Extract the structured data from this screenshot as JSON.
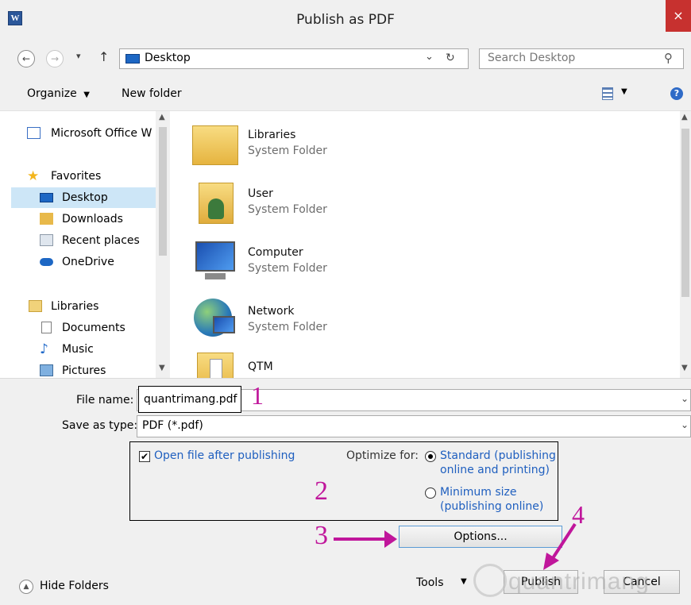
{
  "window": {
    "title": "Publish as PDF",
    "app_icon_letter": "W",
    "close_glyph": "×"
  },
  "address": {
    "back": "←",
    "forward": "→",
    "recent": "▾",
    "up": "↑",
    "location": "Desktop",
    "dropdown": "⌄",
    "refresh": "↻",
    "search_placeholder": "Search Desktop",
    "search_icon": "⚲"
  },
  "toolbar": {
    "organize": "Organize",
    "new_folder": "New folder",
    "view_icon": "view-options-icon",
    "help": "?"
  },
  "sidebar": {
    "items": [
      {
        "label": "Microsoft Office W",
        "icon": "office-icon"
      },
      {
        "label": "Favorites",
        "icon": "star-icon"
      },
      {
        "label": "Desktop",
        "icon": "desktop-icon"
      },
      {
        "label": "Downloads",
        "icon": "downloads-icon"
      },
      {
        "label": "Recent places",
        "icon": "recent-places-icon"
      },
      {
        "label": "OneDrive",
        "icon": "onedrive-icon"
      },
      {
        "label": "Libraries",
        "icon": "libraries-icon"
      },
      {
        "label": "Documents",
        "icon": "documents-icon"
      },
      {
        "label": "Music",
        "icon": "music-icon"
      },
      {
        "label": "Pictures",
        "icon": "pictures-icon"
      }
    ]
  },
  "files": [
    {
      "name": "Libraries",
      "type": "System Folder",
      "icon": "libraries-folder-icon"
    },
    {
      "name": "User",
      "type": "System Folder",
      "icon": "user-folder-icon"
    },
    {
      "name": "Computer",
      "type": "System Folder",
      "icon": "computer-icon"
    },
    {
      "name": "Network",
      "type": "System Folder",
      "icon": "network-icon"
    },
    {
      "name": "QTM",
      "type": "",
      "icon": "folder-icon"
    }
  ],
  "form": {
    "file_name_label": "File name:",
    "file_name_value": "quantrimang.pdf",
    "save_type_label": "Save as type:",
    "save_type_value": "PDF (*.pdf)",
    "open_after_label": "Open file after publishing",
    "open_after_checked": true,
    "optimize_label": "Optimize for:",
    "standard_line1": "Standard (publishing",
    "standard_line2": "online and printing)",
    "minimum_line1": "Minimum size",
    "minimum_line2": "(publishing online)",
    "options_button": "Options...",
    "hide_folders": "Hide Folders",
    "tools": "Tools",
    "publish": "Publish",
    "cancel": "Cancel"
  },
  "annotations": {
    "n1": "1",
    "n2": "2",
    "n3": "3",
    "n4": "4",
    "color": "#c0169b"
  },
  "watermark": "quantrimang"
}
